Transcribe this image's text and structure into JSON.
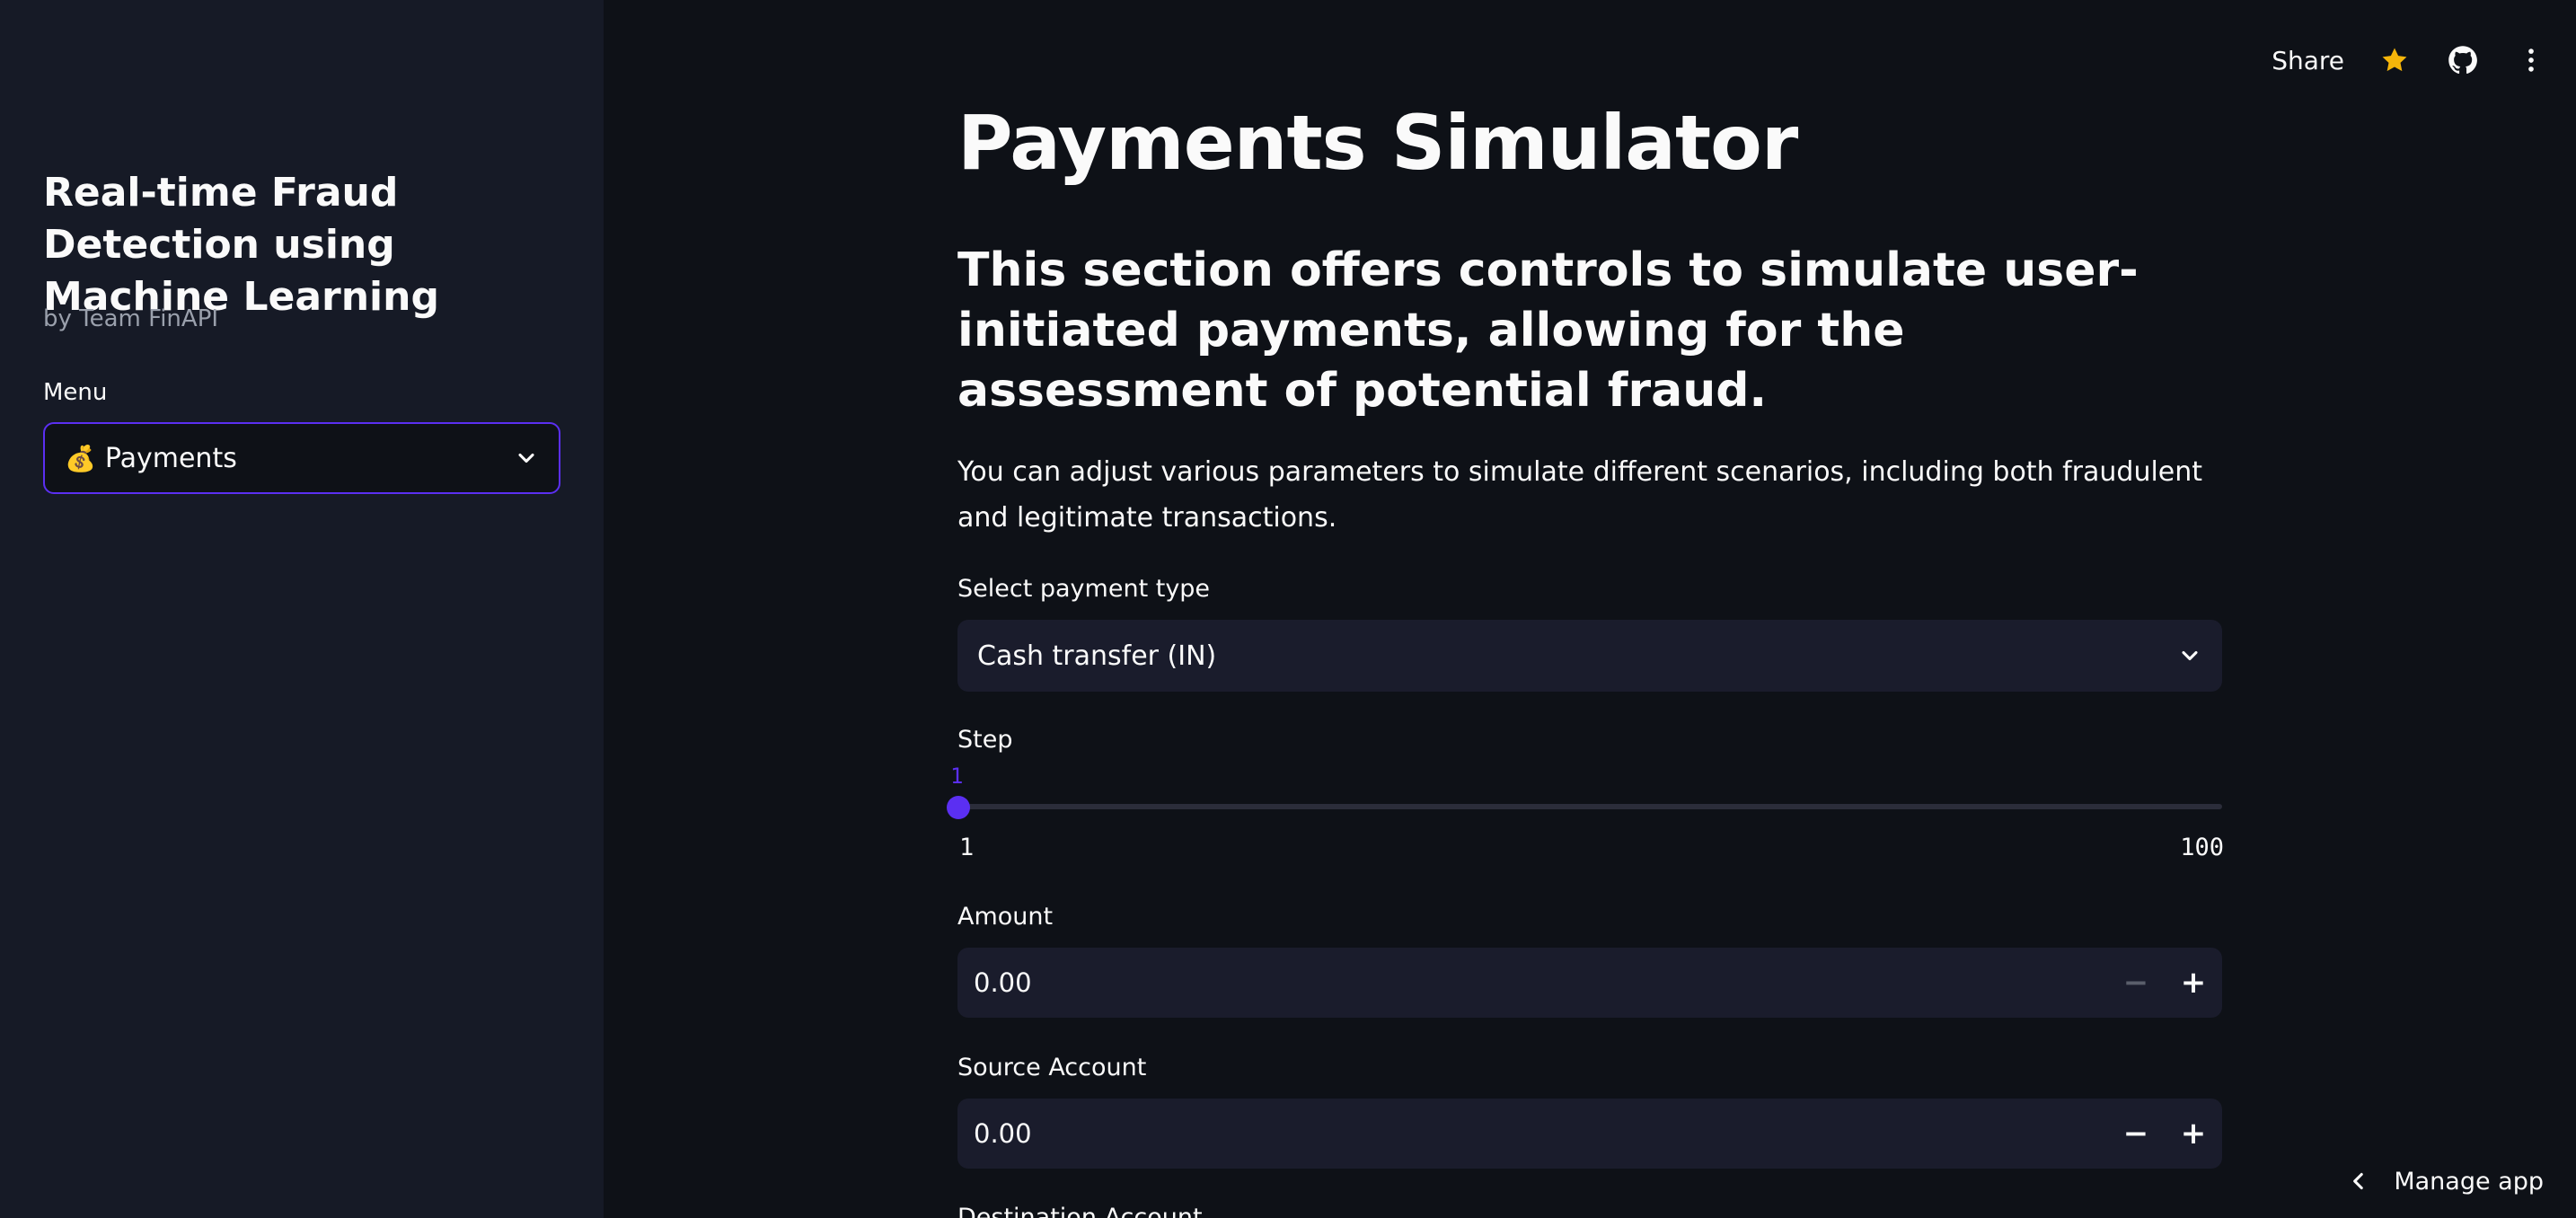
{
  "sidebar": {
    "title": "Real-time Fraud Detection using Machine Learning",
    "byline": "by Team FinAPI",
    "menu_label": "Menu",
    "menu_select": {
      "emoji": "💰",
      "value": "Payments"
    }
  },
  "toolbar": {
    "share_label": "Share",
    "icons": [
      "star-icon",
      "github-icon",
      "more-vertical-icon"
    ],
    "star_color": "#f5b50a"
  },
  "main": {
    "title": "Payments Simulator",
    "subheader": "This section offers controls to simulate user-initiated payments, allowing for the assessment of potential fraud.",
    "description": "You can adjust various parameters to simulate different scenarios, including both fraudulent and legitimate transactions.",
    "payment_type": {
      "label": "Select payment type",
      "value": "Cash transfer (IN)"
    },
    "step": {
      "label": "Step",
      "value": "1",
      "min": "1",
      "max": "100"
    },
    "amount": {
      "label": "Amount",
      "value": "0.00"
    },
    "source_account": {
      "label": "Source Account",
      "value": "0.00"
    },
    "destination_account": {
      "label": "Destination Account"
    }
  },
  "footer": {
    "manage_label": "Manage app"
  },
  "colors": {
    "accent": "#5b2ff2",
    "background": "#0e1117",
    "sidebar": "#161a26",
    "input": "#1a1c2c"
  }
}
